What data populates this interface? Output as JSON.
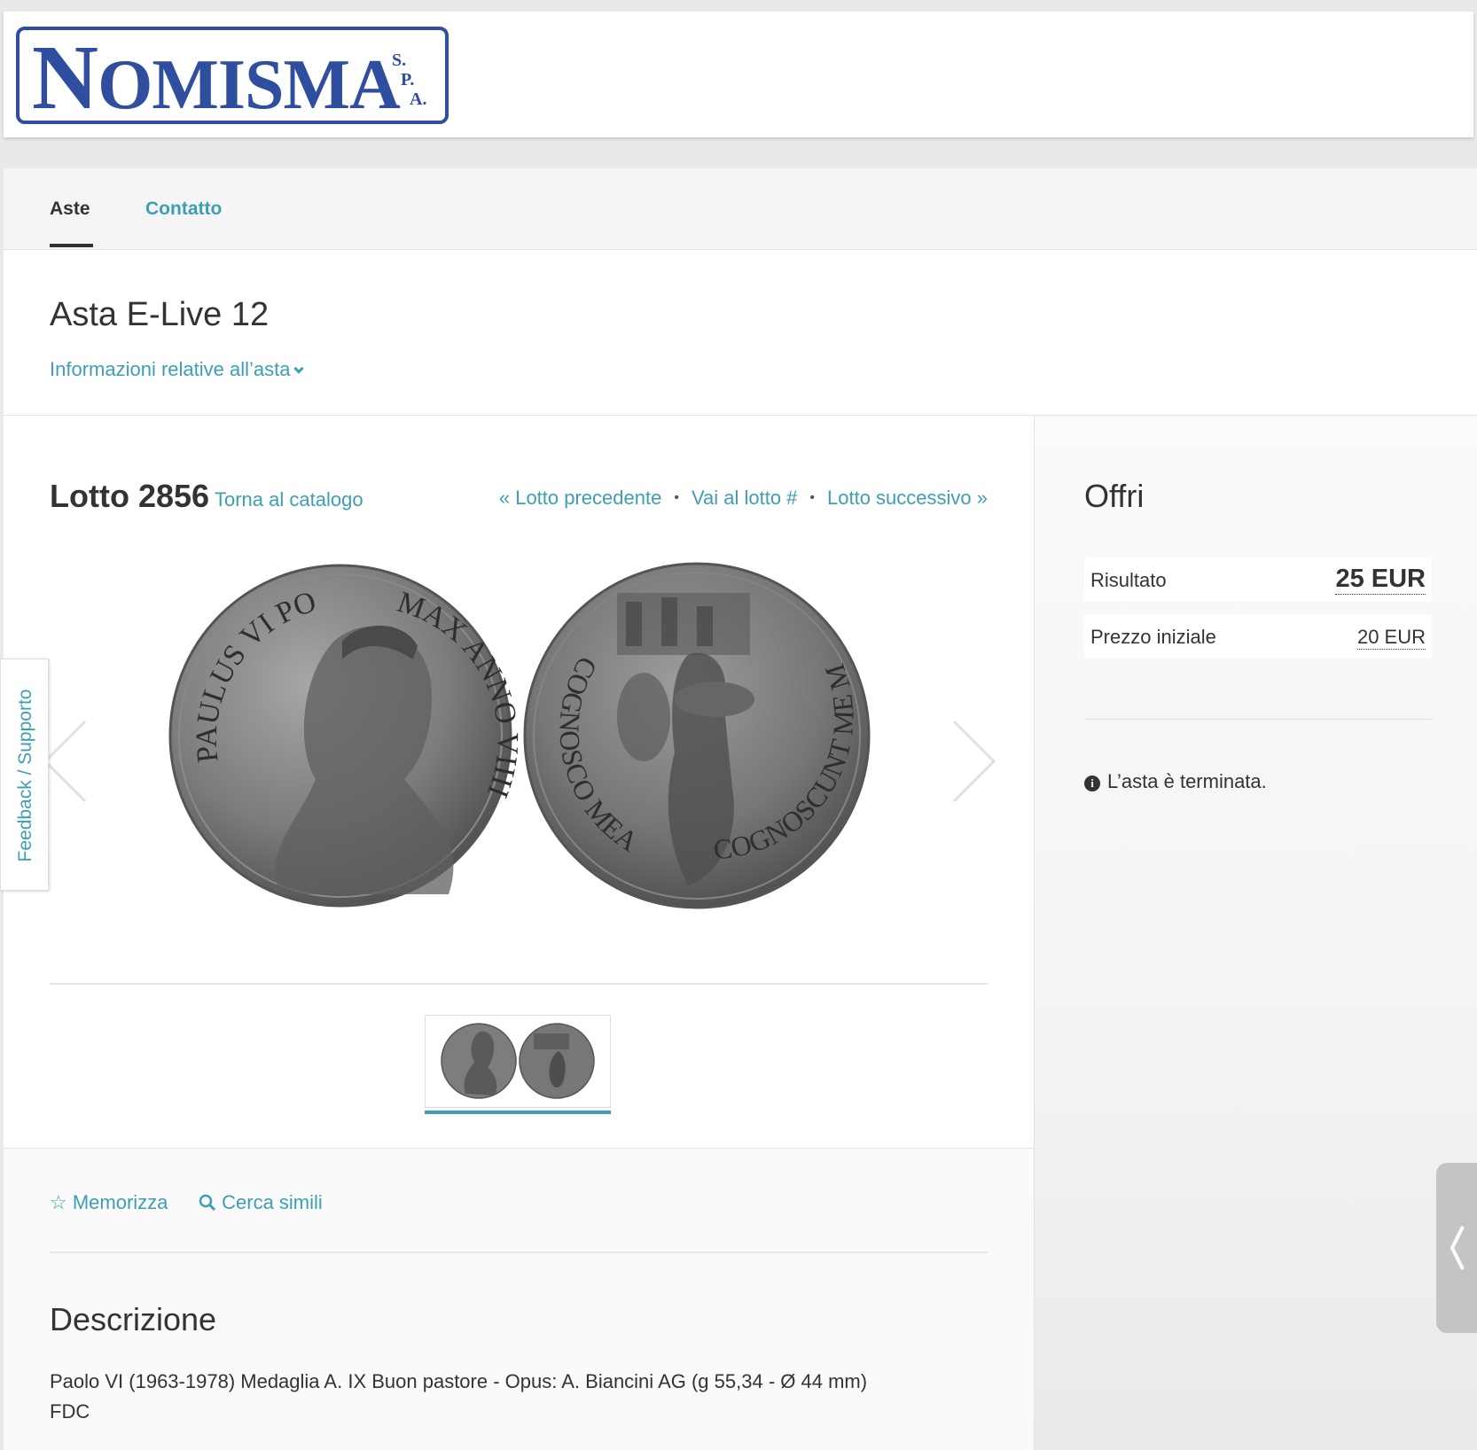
{
  "logo": {
    "text_initial": "N",
    "text_rest": "OMISMA",
    "spa": [
      "S.",
      "P.",
      "A."
    ]
  },
  "nav": {
    "items": [
      {
        "label": "Aste"
      },
      {
        "label": "Contatto"
      }
    ]
  },
  "auction": {
    "title": "Asta E-Live 12",
    "info_link": "Informazioni relative all’asta"
  },
  "lot": {
    "title": "Lotto 2856",
    "back_link": "Torna al catalogo",
    "prev": "« Lotto precedente",
    "goto": "Vai al lotto #",
    "next": "Lotto successivo »",
    "separator": "•"
  },
  "coin": {
    "obverse_legend_left": "PAULUS VI PONT",
    "obverse_legend_right": "MAX ANNO VIIII",
    "reverse_legend_left": "COGNOSCO MEAS ET",
    "reverse_legend_right": "COGNOSCUNT ME MEAE",
    "icon": "coin-image"
  },
  "actions": {
    "memorizza": "Memorizza",
    "cerca": "Cerca simili"
  },
  "description": {
    "title": "Descrizione",
    "line1": "Paolo VI (1963-1978) Medaglia A. IX Buon pastore - Opus: A. Biancini AG (g 55,34 - Ø 44 mm)",
    "line2": "FDC"
  },
  "bid": {
    "title": "Offri",
    "result_label": "Risultato",
    "result_value": "25 EUR",
    "start_label": "Prezzo iniziale",
    "start_value": "20 EUR",
    "ended": "L’asta è terminata."
  },
  "feedback": {
    "label": "Feedback / Supporto"
  },
  "colors": {
    "accent": "#3d9fb3",
    "brand": "#2f4ea0",
    "text": "#333333"
  }
}
